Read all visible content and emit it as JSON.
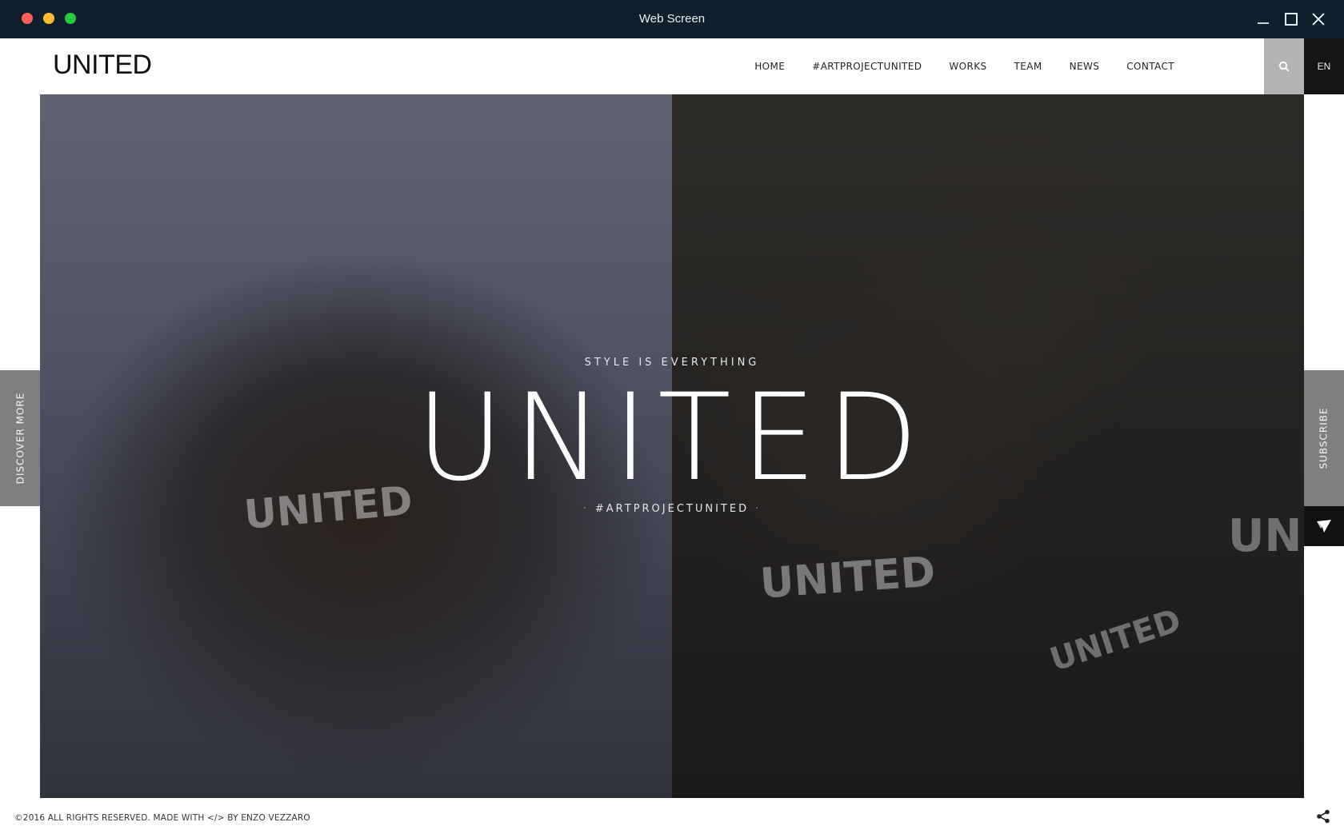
{
  "window": {
    "title": "Web Screen",
    "controls": {
      "close_color": "#ff5f57",
      "minimize_color": "#febc2e",
      "zoom_color": "#28c840"
    }
  },
  "site": {
    "logo": "UNITED",
    "nav": [
      "HOME",
      "#ARTPROJECTUNITED",
      "WORKS",
      "TEAM",
      "NEWS",
      "CONTACT"
    ],
    "search_icon": "search-icon",
    "language": "EN"
  },
  "hero": {
    "kicker": "STYLE IS EVERYTHING",
    "title": "UNITED",
    "tag_prefix": "·",
    "tag": "#ARTPROJECTUNITED",
    "tag_suffix": "·",
    "shirt_prints": [
      "UNITED",
      "UNITED",
      "UNIT",
      "UNITED"
    ]
  },
  "side": {
    "discover": "DISCOVER MORE",
    "subscribe": "SUBSCRIBE",
    "send_icon": "paper-plane-icon"
  },
  "footer": {
    "copyright": "©2016 ALL RIGHTS RESERVED. MADE WITH </> BY ENZO VEZZARO",
    "share_icon": "share-icon"
  }
}
